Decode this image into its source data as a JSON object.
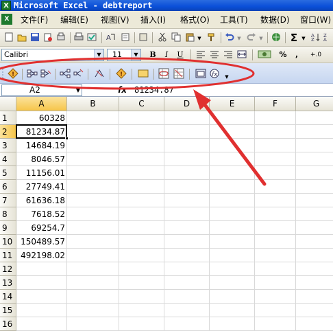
{
  "window": {
    "title": "Microsoft Excel - debtreport",
    "app_icon": "excel-icon"
  },
  "menu": {
    "items": [
      "文件(F)",
      "编辑(E)",
      "视图(V)",
      "插入(I)",
      "格式(O)",
      "工具(T)",
      "数据(D)",
      "窗口(W)"
    ]
  },
  "toolbar_standard": {
    "icons": [
      "new-icon",
      "open-icon",
      "save-icon",
      "permission-icon",
      "print-preview-icon",
      "print-icon",
      "spelling-icon",
      "research-icon",
      "cut-icon",
      "copy-icon",
      "paste-icon",
      "format-painter-icon",
      "undo-icon",
      "redo-icon",
      "hyperlink-icon",
      "autosum-icon"
    ],
    "autosum_label": "Σ"
  },
  "toolbar_formatting": {
    "font_name": "Calibri",
    "font_size": "11",
    "bold_label": "B",
    "italic_label": "I",
    "underline_label": "U",
    "percent_label": "%",
    "comma_label": ",",
    "decimal_label": "+.0"
  },
  "toolbar_formula_auditing": {
    "icons": [
      "error-checking-icon",
      "trace-precedents-icon",
      "remove-precedent-arrows-icon",
      "trace-dependents-icon",
      "remove-dependent-arrows-icon",
      "remove-all-arrows-icon",
      "trace-error-icon",
      "new-comment-icon",
      "circle-invalid-data-icon",
      "clear-validation-circles-icon",
      "show-watch-window-icon",
      "evaluate-formula-icon"
    ],
    "highlight_color": "#e03030"
  },
  "formula_bar": {
    "name_box": "A2",
    "fx_label": "fx",
    "value": "81234.87"
  },
  "sheet": {
    "columns": [
      "A",
      "B",
      "C",
      "D",
      "E",
      "F",
      "G"
    ],
    "active_column": "A",
    "active_row": "2",
    "rows": [
      {
        "num": "1",
        "A": "60328"
      },
      {
        "num": "2",
        "A": "81234.87"
      },
      {
        "num": "3",
        "A": "14684.19"
      },
      {
        "num": "4",
        "A": "8046.57"
      },
      {
        "num": "5",
        "A": "11156.01"
      },
      {
        "num": "6",
        "A": "27749.41"
      },
      {
        "num": "7",
        "A": "61636.18"
      },
      {
        "num": "8",
        "A": "7618.52"
      },
      {
        "num": "9",
        "A": "69254.7"
      },
      {
        "num": "10",
        "A": "150489.57"
      },
      {
        "num": "11",
        "A": "492198.02"
      },
      {
        "num": "12",
        "A": ""
      },
      {
        "num": "13",
        "A": ""
      },
      {
        "num": "14",
        "A": ""
      },
      {
        "num": "15",
        "A": ""
      },
      {
        "num": "16",
        "A": ""
      }
    ]
  }
}
